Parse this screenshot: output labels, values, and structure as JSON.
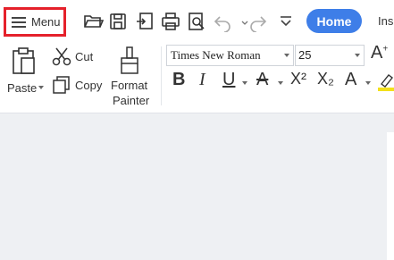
{
  "toolbar": {
    "menu_label": "Menu",
    "icons": [
      "open-folder-icon",
      "save-icon",
      "export-icon",
      "print-icon",
      "print-preview-icon",
      "undo-icon",
      "redo-icon",
      "more-chevron-icon"
    ]
  },
  "tabs": {
    "home": "Home",
    "insert": "Ins"
  },
  "ribbon": {
    "paste_label": "Paste",
    "cut_label": "Cut",
    "copy_label": "Copy",
    "format_painter_label_1": "Format",
    "format_painter_label_2": "Painter",
    "font_name": "Times New Roman",
    "font_size": "25",
    "bold": "B",
    "italic": "I",
    "underline": "U",
    "strike": "A",
    "superscript": "X²",
    "subscript": "X₂",
    "text_effect": "A"
  },
  "colors": {
    "accent": "#3e7ee8",
    "menu_highlight": "#e5212b",
    "background": "#eef0f3"
  }
}
